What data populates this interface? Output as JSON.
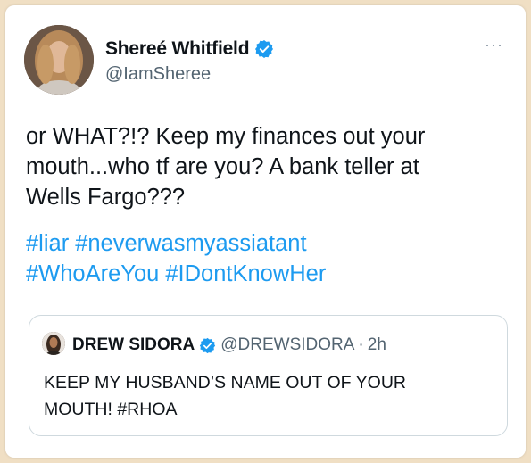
{
  "tweet": {
    "display_name": "Shereé Whitfield",
    "handle": "@IamSheree",
    "more_glyph": "···",
    "body_lines": [
      "or WHAT?!? Keep my finances out your",
      "mouth...who tf are you? A bank teller at",
      "Wells Fargo???"
    ],
    "hashtag_lines": [
      [
        "#liar",
        "#neverwasmyassiatant"
      ],
      [
        "#WhoAreYou",
        "#IDontKnowHer"
      ]
    ],
    "verified_icon": "verified-badge-icon"
  },
  "quoted_tweet": {
    "display_name": "DREW SIDORA",
    "handle": "@DREWSIDORA",
    "separator": "·",
    "time": "2h",
    "text_lines": [
      "KEEP MY HUSBAND’S NAME OUT OF YOUR",
      "MOUTH! #RHOA"
    ]
  },
  "colors": {
    "background": "#f0dfc4",
    "card": "#ffffff",
    "text": "#0f1419",
    "secondary": "#536471",
    "link": "#1d9bf0",
    "verified": "#1d9bf0",
    "border": "#cfd9de"
  }
}
